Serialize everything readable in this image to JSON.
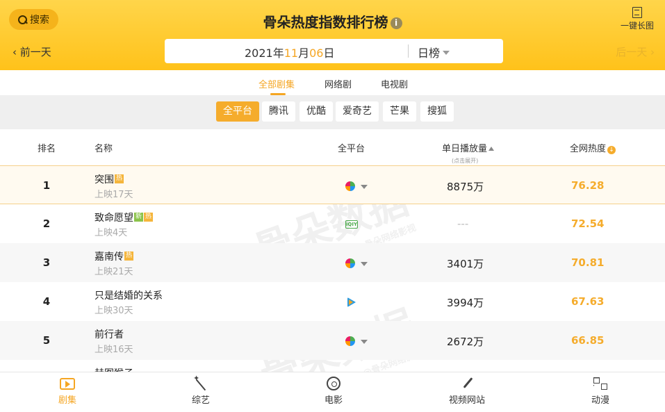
{
  "header": {
    "search_label": "搜索",
    "title": "骨朵热度指数排行榜",
    "info_glyph": "i",
    "long_image_label": "一键长图",
    "prev_label": "前一天",
    "next_label": "后一天",
    "date_year": "2021",
    "date_year_unit": "年",
    "date_month": "11",
    "date_month_unit": "月",
    "date_day": "06",
    "date_day_unit": "日",
    "period": "日榜"
  },
  "category_tabs": [
    {
      "label": "全部剧集",
      "active": true
    },
    {
      "label": "网络剧",
      "active": false
    },
    {
      "label": "电视剧",
      "active": false
    }
  ],
  "platforms": [
    {
      "label": "全平台",
      "active": true
    },
    {
      "label": "腾讯",
      "active": false
    },
    {
      "label": "优酷",
      "active": false
    },
    {
      "label": "爱奇艺",
      "active": false
    },
    {
      "label": "芒果",
      "active": false
    },
    {
      "label": "搜狐",
      "active": false
    }
  ],
  "table_header": {
    "rank": "排名",
    "name": "名称",
    "platform": "全平台",
    "plays": "单日播放量",
    "plays_hint": "(点击展开)",
    "heat": "全网热度"
  },
  "rows": [
    {
      "rank": "1",
      "name": "突围",
      "sub": "上映17天",
      "badges": [
        "热"
      ],
      "platform_icon": "multi-platform-icon",
      "plays": "8875万",
      "heat": "76.28"
    },
    {
      "rank": "2",
      "name": "致命愿望",
      "sub": "上映4天",
      "badges": [
        "新",
        "热"
      ],
      "platform_icon": "iqiyi-icon",
      "platform_text": "iQIY",
      "plays": "---",
      "heat": "72.54"
    },
    {
      "rank": "3",
      "name": "嘉南传",
      "sub": "上映21天",
      "badges": [
        "热"
      ],
      "platform_icon": "multi-platform-icon",
      "plays": "3401万",
      "heat": "70.81"
    },
    {
      "rank": "4",
      "name": "只是结婚的关系",
      "sub": "上映30天",
      "badges": [],
      "platform_icon": "tencent-video-icon",
      "plays": "3994万",
      "heat": "67.63"
    },
    {
      "rank": "5",
      "name": "前行者",
      "sub": "上映16天",
      "badges": [],
      "platform_icon": "multi-platform-icon",
      "plays": "2672万",
      "heat": "66.85"
    },
    {
      "rank": "",
      "name": "赫图猴子",
      "sub": "",
      "badges": [],
      "platform_icon": "",
      "plays": "",
      "heat": ""
    }
  ],
  "watermark": {
    "main": "骨朵数据",
    "sub": "@骨朵网络影视"
  },
  "bottom_nav": [
    {
      "label": "剧集",
      "icon": "tv-icon",
      "active": true
    },
    {
      "label": "综艺",
      "icon": "magic-wand-icon",
      "active": false
    },
    {
      "label": "电影",
      "icon": "film-reel-icon",
      "active": false
    },
    {
      "label": "视频网站",
      "icon": "brush-icon",
      "active": false
    },
    {
      "label": "动漫",
      "icon": "blocks-icon",
      "active": false
    }
  ],
  "colors": {
    "accent": "#f5ac2c",
    "header_top": "#ffd54a",
    "header_bottom": "#ffc21a"
  }
}
